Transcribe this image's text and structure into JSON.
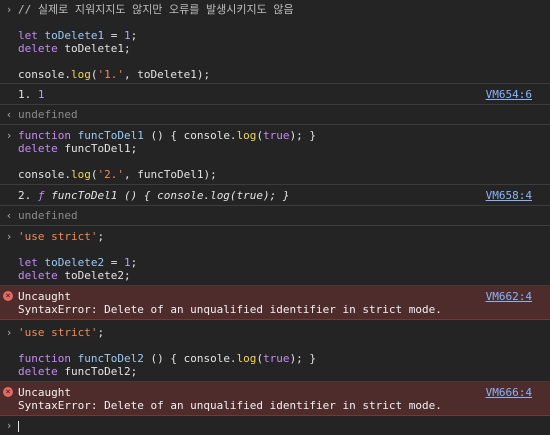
{
  "entries": {
    "e1": {
      "l1": "// 실제로 지워지지도 않지만 오류를 발생시키지도 않음"
    },
    "e2": {
      "let": "let",
      "var": "toDelete1",
      "eq": " = ",
      "num": "1",
      "semi": ";",
      "del": "delete",
      "var2": " toDelete1;"
    },
    "e3": {
      "obj": "console.",
      "method": "log",
      "open": "(",
      "str": "'1.'",
      "rest": ", toDelete1);"
    },
    "r1": {
      "label": "1.",
      "value": "1",
      "src": "VM654:6"
    },
    "u1": {
      "text": "undefined"
    },
    "e4": {
      "kw": "function",
      "name": "funcToDel1",
      "rest1": " () { console.",
      "method": "log",
      "open": "(",
      "bool": "true",
      "rest2": "); }",
      "del": "delete",
      "rest3": " funcToDel1;",
      "obj": "console.",
      "method2": "log",
      "open2": "(",
      "str": "'2.'",
      "rest4": ", funcToDel1);"
    },
    "r2": {
      "label": "2.",
      "f": "ƒ",
      "sig": "funcToDel1 () { console.log(true); }",
      "src": "VM658:4"
    },
    "u2": {
      "text": "undefined"
    },
    "e5": {
      "str": "'use strict'",
      "semi": ";",
      "let": "let",
      "var": "toDelete2",
      "eq": " = ",
      "num": "1",
      "semi2": ";",
      "del": "delete",
      "var2": " toDelete2;"
    },
    "err1": {
      "title": "Uncaught",
      "msg": "SyntaxError: Delete of an unqualified identifier in strict mode.",
      "src": "VM662:4"
    },
    "e6": {
      "str": "'use strict'",
      "semi": ";",
      "kw": "function",
      "name": "funcToDel2",
      "rest1": " () { console.",
      "method": "log",
      "open": "(",
      "bool": "true",
      "rest2": "); }",
      "del": "delete",
      "rest3": " funcToDel2;"
    },
    "err2": {
      "title": "Uncaught",
      "msg": "SyntaxError: Delete of an unqualified identifier in strict mode.",
      "src": "VM666:4"
    }
  },
  "icons": {
    "prompt": "›",
    "result": "‹",
    "error": "×"
  }
}
